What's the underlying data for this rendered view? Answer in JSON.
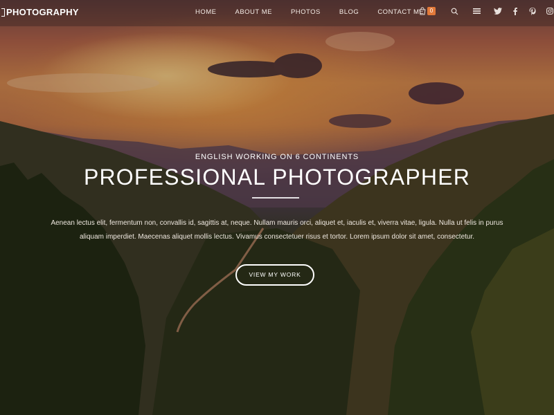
{
  "header": {
    "logo_text": "PHOTOGRAPHY",
    "nav": [
      "HOME",
      "ABOUT ME",
      "PHOTOS",
      "BLOG",
      "CONTACT ME"
    ],
    "cart_count": "0",
    "icons": [
      "cart-icon",
      "search-icon",
      "menu-icon",
      "twitter-icon",
      "facebook-icon",
      "pinterest-icon",
      "instagram-icon"
    ]
  },
  "hero": {
    "kicker": "ENGLISH WORKING ON 6 CONTINENTS",
    "headline": "PROFESSIONAL PHOTOGRAPHER",
    "body": "Aenean lectus elit, fermentum non, convallis id, sagittis at, neque. Nullam mauris orci, aliquet et, iaculis et, viverra vitae, ligula. Nulla ut felis in purus aliquam imperdiet. Maecenas aliquet mollis lectus. Vivamus consectetuer risus et tortor. Lorem ipsum dolor sit amet, consectetur.",
    "cta_label": "VIEW MY WORK"
  },
  "colors": {
    "accent": "#e37a3a",
    "text": "#ffffff"
  }
}
